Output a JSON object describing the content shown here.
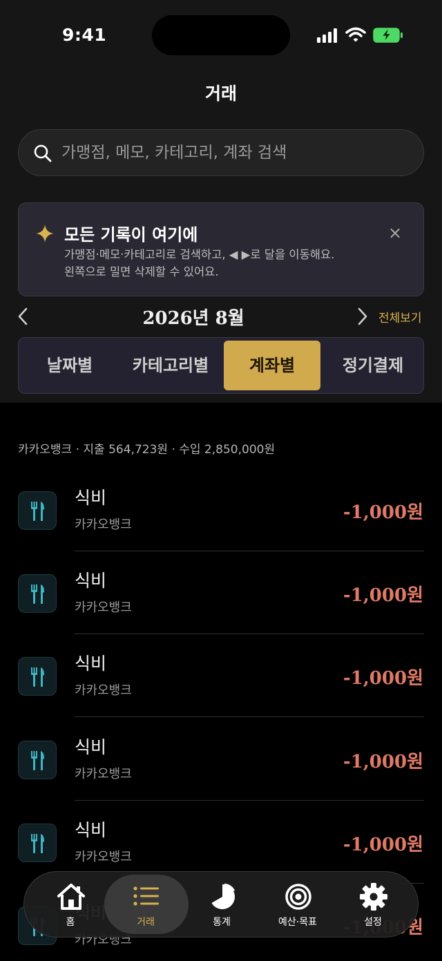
{
  "status": {
    "time": "9:41"
  },
  "header": {
    "title": "거래"
  },
  "search": {
    "placeholder": "가맹점, 메모, 카테고리, 계좌 검색"
  },
  "tip": {
    "title": "모든 기록이 여기에",
    "line1": "가맹점·메모·카테고리로 검색하고, ◀ ▶로 달을 이동해요.",
    "line2": "왼쪽으로 밀면 삭제할 수 있어요.",
    "close": "×"
  },
  "month": {
    "label": "2026년 8월",
    "view_all": "전체보기"
  },
  "segments": [
    {
      "label": "날짜별",
      "active": false
    },
    {
      "label": "카테고리별",
      "active": false
    },
    {
      "label": "계좌별",
      "active": true
    },
    {
      "label": "정기결제",
      "active": false
    }
  ],
  "summary": "카카오뱅크 · 지출 564,723원 · 수입 2,850,000원",
  "transactions": [
    {
      "name": "식비",
      "account": "카카오뱅크",
      "amount": "-1,000원",
      "icon": "utensils-icon"
    },
    {
      "name": "식비",
      "account": "카카오뱅크",
      "amount": "-1,000원",
      "icon": "utensils-icon"
    },
    {
      "name": "식비",
      "account": "카카오뱅크",
      "amount": "-1,000원",
      "icon": "utensils-icon"
    },
    {
      "name": "식비",
      "account": "카카오뱅크",
      "amount": "-1,000원",
      "icon": "utensils-icon"
    },
    {
      "name": "식비",
      "account": "카카오뱅크",
      "amount": "-1,000원",
      "icon": "utensils-icon"
    },
    {
      "name": "식비",
      "account": "카카오뱅크",
      "amount": "-1,000원",
      "icon": "utensils-icon"
    }
  ],
  "tabbar": [
    {
      "label": "홈",
      "icon": "home-icon",
      "active": false
    },
    {
      "label": "거래",
      "icon": "list-icon",
      "active": true
    },
    {
      "label": "통계",
      "icon": "pie-chart-icon",
      "active": false
    },
    {
      "label": "예산·목표",
      "icon": "target-icon",
      "active": false
    },
    {
      "label": "설정",
      "icon": "gear-icon",
      "active": false
    }
  ],
  "colors": {
    "accent": "#d2aa4e",
    "expense": "#e07a66",
    "icon_teal": "#3fb6c4"
  }
}
